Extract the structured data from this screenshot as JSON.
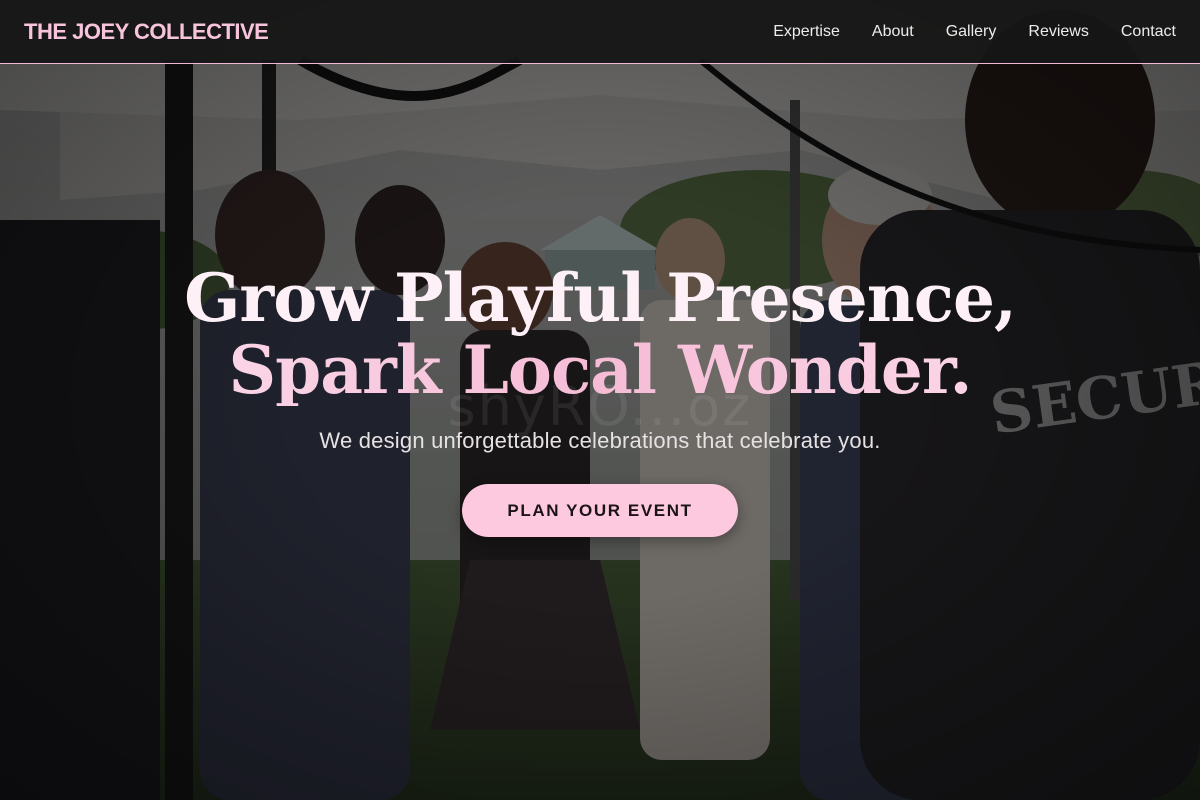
{
  "brand": {
    "name": "THE JOEY COLLECTIVE",
    "accent_color": "#f7c4dc"
  },
  "nav": {
    "items": [
      {
        "label": "Expertise"
      },
      {
        "label": "About"
      },
      {
        "label": "Gallery"
      },
      {
        "label": "Reviews"
      },
      {
        "label": "Contact"
      }
    ]
  },
  "hero": {
    "headline_line1": "Grow Playful Presence,",
    "headline_line2": "Spark Local Wonder.",
    "subtitle": "We design unforgettable celebrations that celebrate you.",
    "cta_label": "PLAN YOUR EVENT",
    "cta_color": "#fcc9df",
    "watermark_text": "shyRO...oz",
    "background_image": "outdoor-event-crowd-photo"
  }
}
